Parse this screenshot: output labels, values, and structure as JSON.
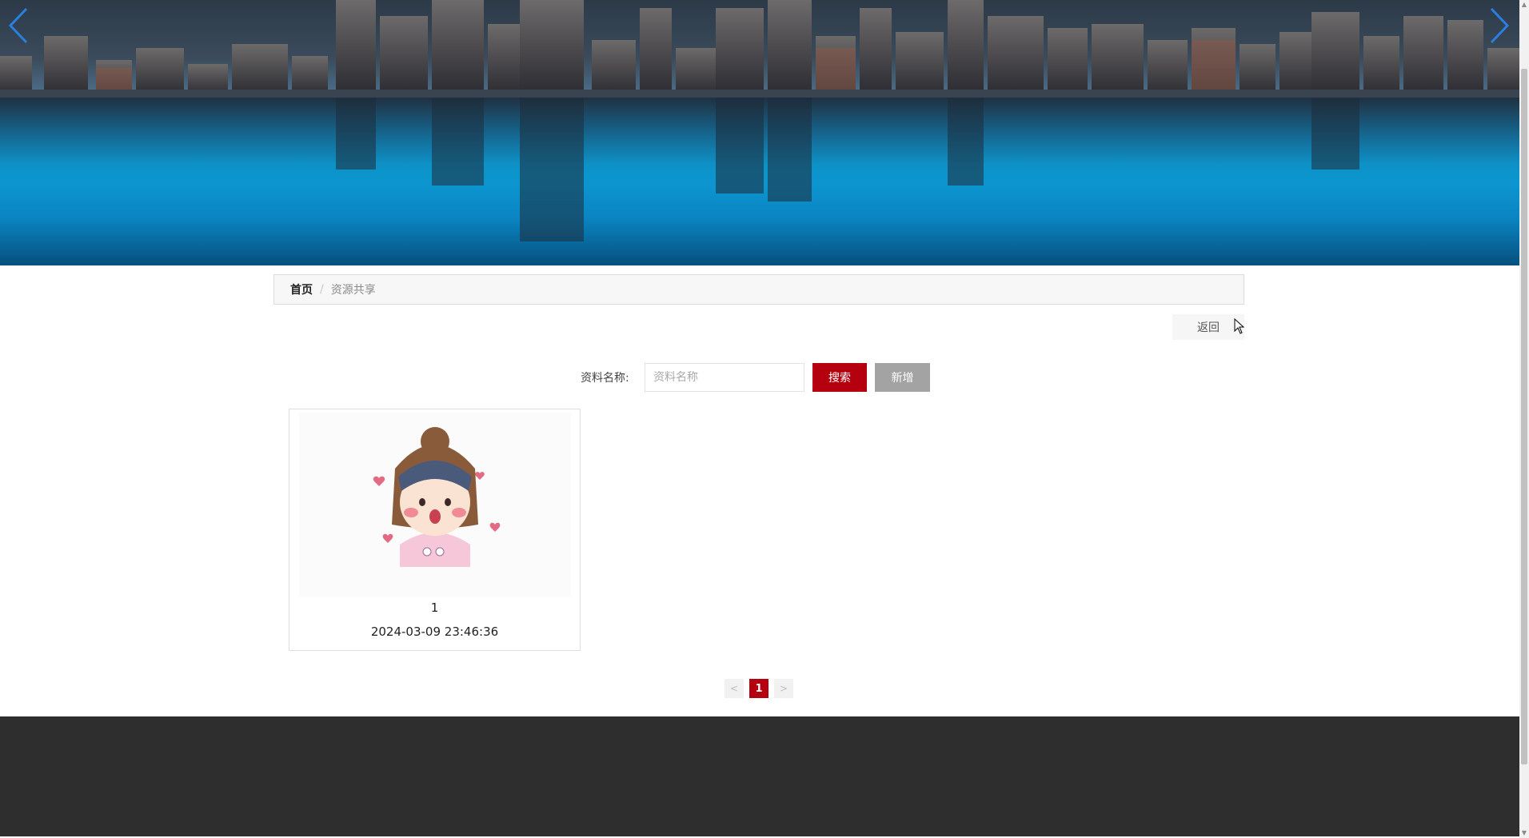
{
  "banner": {
    "prev_icon": "chevron-left-icon",
    "next_icon": "chevron-right-icon",
    "arrow_color": "#2a7fe0"
  },
  "breadcrumb": {
    "home": "首页",
    "separator": "/",
    "current": "资源共享"
  },
  "back_button": {
    "label": "返回"
  },
  "search": {
    "label": "资料名称:",
    "placeholder": "资料名称",
    "value": "",
    "search_button": "搜索",
    "add_button": "新增"
  },
  "resources": [
    {
      "title": "1",
      "time": "2024-03-09 23:46:36",
      "image": "cartoon-girl-avatar"
    }
  ],
  "pagination": {
    "prev": "<",
    "current": "1",
    "next": ">"
  },
  "colors": {
    "accent": "#b5000f",
    "secondary_button": "#a3a3a3",
    "footer": "#2e2e2e"
  }
}
